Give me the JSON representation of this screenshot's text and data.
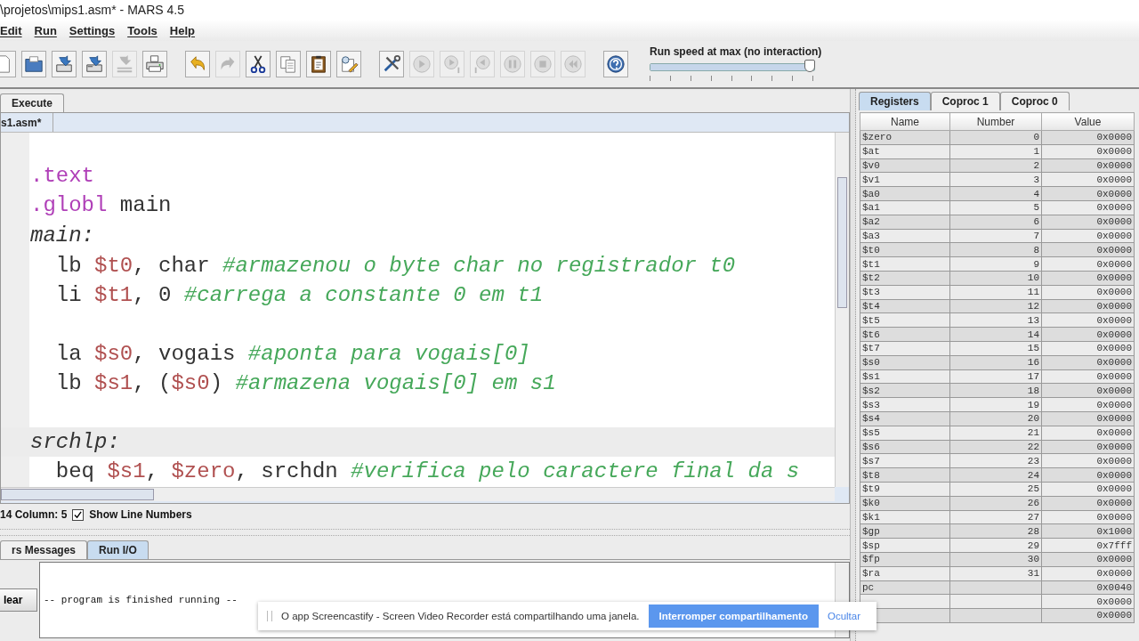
{
  "window": {
    "title": "\\projetos\\mips1.asm* - MARS 4.5"
  },
  "menu": [
    "Edit",
    "Run",
    "Settings",
    "Tools",
    "Help"
  ],
  "toolbar": [
    {
      "kind": "new",
      "disabled": false
    },
    {
      "kind": "open",
      "disabled": false
    },
    {
      "kind": "save",
      "disabled": false
    },
    {
      "kind": "saveas",
      "disabled": false
    },
    {
      "kind": "dump",
      "disabled": true
    },
    {
      "kind": "print",
      "disabled": false
    },
    {
      "kind": "sep"
    },
    {
      "kind": "undo",
      "disabled": false
    },
    {
      "kind": "redo",
      "disabled": true
    },
    {
      "kind": "cut",
      "disabled": false
    },
    {
      "kind": "copy",
      "disabled": false
    },
    {
      "kind": "paste",
      "disabled": false
    },
    {
      "kind": "find",
      "disabled": false
    },
    {
      "kind": "sep"
    },
    {
      "kind": "assemble",
      "disabled": false
    },
    {
      "kind": "run",
      "disabled": true
    },
    {
      "kind": "step",
      "disabled": true
    },
    {
      "kind": "backstep",
      "disabled": true
    },
    {
      "kind": "pause",
      "disabled": true
    },
    {
      "kind": "stop",
      "disabled": true
    },
    {
      "kind": "reset",
      "disabled": true
    },
    {
      "kind": "sep"
    },
    {
      "kind": "help",
      "disabled": false
    }
  ],
  "speed": {
    "label": "Run speed at max (no interaction)",
    "level": 1
  },
  "main_tabs": [
    {
      "label": "Execute",
      "selected": false
    }
  ],
  "file_tab": {
    "label": "s1.asm*"
  },
  "editor": {
    "lines": [
      {
        "kind": "blank"
      },
      {
        "kind": "code",
        "tokens": [
          {
            "kind": "directive",
            "text": ".text"
          }
        ]
      },
      {
        "kind": "code",
        "tokens": [
          {
            "kind": "directive",
            "text": ".globl"
          },
          {
            "kind": "plain",
            "text": " main"
          }
        ]
      },
      {
        "kind": "code",
        "tokens": [
          {
            "kind": "label",
            "text": "main:"
          }
        ]
      },
      {
        "kind": "code",
        "tokens": [
          {
            "kind": "plain",
            "text": "  lb "
          },
          {
            "kind": "register",
            "text": "$t0"
          },
          {
            "kind": "plain",
            "text": ", char "
          },
          {
            "kind": "comment",
            "text": "#armazenou o byte char no registrador t0"
          }
        ]
      },
      {
        "kind": "code",
        "tokens": [
          {
            "kind": "plain",
            "text": "  li "
          },
          {
            "kind": "register",
            "text": "$t1"
          },
          {
            "kind": "plain",
            "text": ", 0 "
          },
          {
            "kind": "comment",
            "text": "#carrega a constante 0 em t1"
          }
        ]
      },
      {
        "kind": "blank"
      },
      {
        "kind": "code",
        "tokens": [
          {
            "kind": "plain",
            "text": "  la "
          },
          {
            "kind": "register",
            "text": "$s0"
          },
          {
            "kind": "plain",
            "text": ", vogais "
          },
          {
            "kind": "comment",
            "text": "#aponta para vogais[0]"
          }
        ]
      },
      {
        "kind": "code",
        "tokens": [
          {
            "kind": "plain",
            "text": "  lb "
          },
          {
            "kind": "register",
            "text": "$s1"
          },
          {
            "kind": "plain",
            "text": ", ("
          },
          {
            "kind": "register",
            "text": "$s0"
          },
          {
            "kind": "plain",
            "text": ") "
          },
          {
            "kind": "comment",
            "text": "#armazena vogais[0] em s1"
          }
        ]
      },
      {
        "kind": "blank"
      },
      {
        "kind": "code",
        "current": true,
        "tokens": [
          {
            "kind": "label",
            "text": "srchlp:"
          }
        ]
      },
      {
        "kind": "code",
        "tokens": [
          {
            "kind": "plain",
            "text": "  beq "
          },
          {
            "kind": "register",
            "text": "$s1"
          },
          {
            "kind": "plain",
            "text": ", "
          },
          {
            "kind": "register",
            "text": "$zero"
          },
          {
            "kind": "plain",
            "text": ", srchdn "
          },
          {
            "kind": "comment",
            "text": "#verifica pelo caractere final da s"
          }
        ]
      }
    ]
  },
  "status": {
    "position": "14 Column: 5",
    "show_line_numbers": {
      "label": "Show Line Numbers",
      "checked": true
    }
  },
  "bottom_tabs": [
    {
      "label": "rs Messages",
      "selected": false
    },
    {
      "label": "Run I/O",
      "selected": true
    }
  ],
  "clear_button": "lear",
  "output": "-- program is finished running --",
  "register_tabs": [
    {
      "label": "Registers",
      "selected": true
    },
    {
      "label": "Coproc 1",
      "selected": false
    },
    {
      "label": "Coproc 0",
      "selected": false
    }
  ],
  "registers": {
    "columns": [
      "Name",
      "Number",
      "Value"
    ],
    "rows": [
      {
        "name": "$zero",
        "number": "0",
        "value": "0x0000"
      },
      {
        "name": "$at",
        "number": "1",
        "value": "0x0000"
      },
      {
        "name": "$v0",
        "number": "2",
        "value": "0x0000"
      },
      {
        "name": "$v1",
        "number": "3",
        "value": "0x0000"
      },
      {
        "name": "$a0",
        "number": "4",
        "value": "0x0000"
      },
      {
        "name": "$a1",
        "number": "5",
        "value": "0x0000"
      },
      {
        "name": "$a2",
        "number": "6",
        "value": "0x0000"
      },
      {
        "name": "$a3",
        "number": "7",
        "value": "0x0000"
      },
      {
        "name": "$t0",
        "number": "8",
        "value": "0x0000"
      },
      {
        "name": "$t1",
        "number": "9",
        "value": "0x0000"
      },
      {
        "name": "$t2",
        "number": "10",
        "value": "0x0000"
      },
      {
        "name": "$t3",
        "number": "11",
        "value": "0x0000"
      },
      {
        "name": "$t4",
        "number": "12",
        "value": "0x0000"
      },
      {
        "name": "$t5",
        "number": "13",
        "value": "0x0000"
      },
      {
        "name": "$t6",
        "number": "14",
        "value": "0x0000"
      },
      {
        "name": "$t7",
        "number": "15",
        "value": "0x0000"
      },
      {
        "name": "$s0",
        "number": "16",
        "value": "0x0000"
      },
      {
        "name": "$s1",
        "number": "17",
        "value": "0x0000"
      },
      {
        "name": "$s2",
        "number": "18",
        "value": "0x0000"
      },
      {
        "name": "$s3",
        "number": "19",
        "value": "0x0000"
      },
      {
        "name": "$s4",
        "number": "20",
        "value": "0x0000"
      },
      {
        "name": "$s5",
        "number": "21",
        "value": "0x0000"
      },
      {
        "name": "$s6",
        "number": "22",
        "value": "0x0000"
      },
      {
        "name": "$s7",
        "number": "23",
        "value": "0x0000"
      },
      {
        "name": "$t8",
        "number": "24",
        "value": "0x0000"
      },
      {
        "name": "$t9",
        "number": "25",
        "value": "0x0000"
      },
      {
        "name": "$k0",
        "number": "26",
        "value": "0x0000"
      },
      {
        "name": "$k1",
        "number": "27",
        "value": "0x0000"
      },
      {
        "name": "$gp",
        "number": "28",
        "value": "0x1000"
      },
      {
        "name": "$sp",
        "number": "29",
        "value": "0x7fff"
      },
      {
        "name": "$fp",
        "number": "30",
        "value": "0x0000"
      },
      {
        "name": "$ra",
        "number": "31",
        "value": "0x0000"
      },
      {
        "name": "pc",
        "value": "0x0040"
      },
      {
        "value": "0x0000"
      },
      {
        "value": "0x0000"
      }
    ]
  },
  "notification": {
    "text": "O app Screencastify - Screen Video Recorder está compartilhando uma janela.",
    "button": "Interromper compartilhamento",
    "link": "Ocultar"
  }
}
